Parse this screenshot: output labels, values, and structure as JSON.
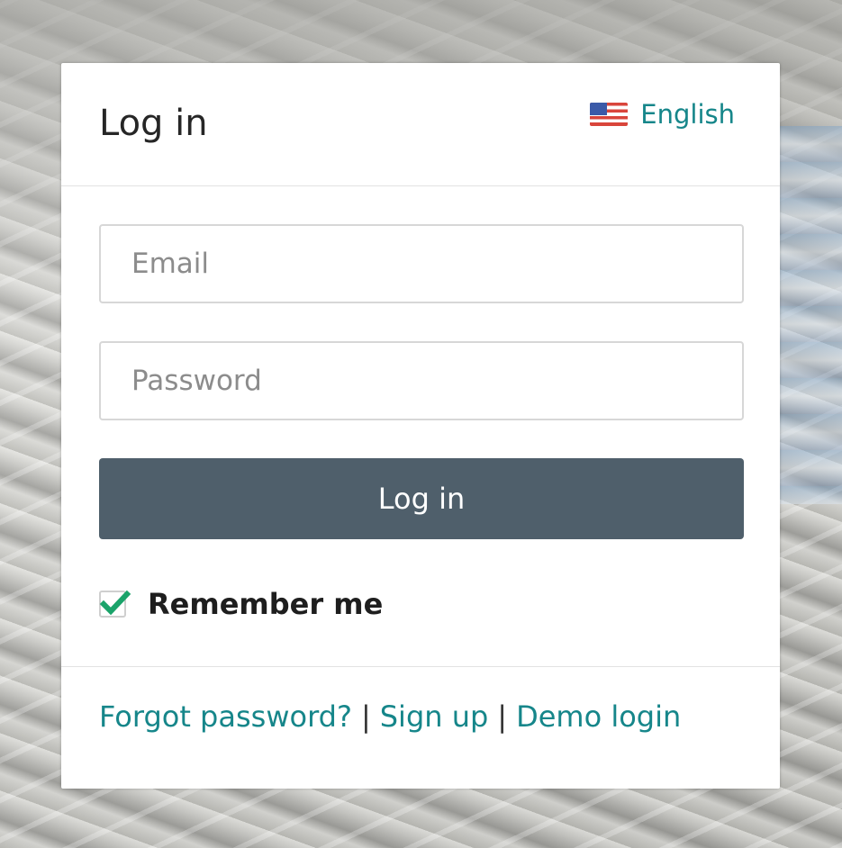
{
  "header": {
    "title": "Log in",
    "language": {
      "label": "English",
      "icon": "us-flag-icon"
    }
  },
  "form": {
    "email_placeholder": "Email",
    "password_placeholder": "Password",
    "submit_label": "Log in",
    "remember_label": "Remember me",
    "remember_checked": true
  },
  "footer": {
    "links": [
      {
        "label": "Forgot password?"
      },
      {
        "label": "Sign up"
      },
      {
        "label": "Demo login"
      }
    ],
    "separator": "|"
  },
  "colors": {
    "accent": "#16868a",
    "button": "#4f5f6b",
    "check": "#1aa36a"
  }
}
